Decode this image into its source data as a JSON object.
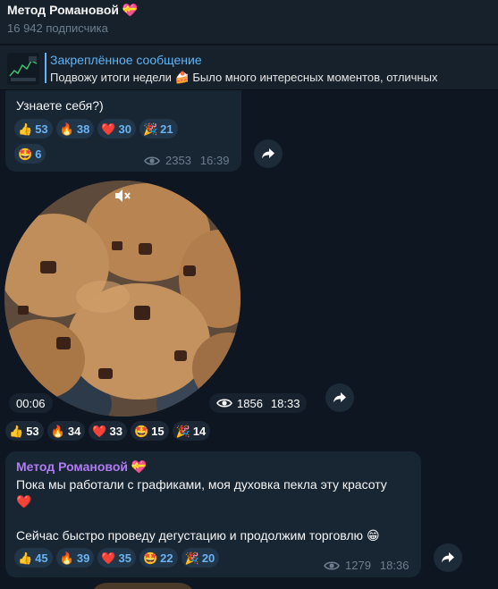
{
  "channel": {
    "title": "Метод Романовой",
    "title_emoji": "💝",
    "subscribers": "16 942 подписчика"
  },
  "pinned": {
    "label": "Закреплённое сообщение",
    "text": "Подвожу итоги недели 🍰   Было много интересных моментов, отличных"
  },
  "message1": {
    "text": "Узнаете себя?)",
    "reactions": [
      {
        "emoji": "👍",
        "count": "53"
      },
      {
        "emoji": "🔥",
        "count": "38"
      },
      {
        "emoji": "❤️",
        "count": "30"
      },
      {
        "emoji": "🎉",
        "count": "21"
      },
      {
        "emoji": "🤩",
        "count": "6"
      }
    ],
    "views": "2353",
    "time": "16:39"
  },
  "video_message": {
    "duration": "00:06",
    "views": "1856",
    "time": "18:33",
    "reactions": [
      {
        "emoji": "👍",
        "count": "53"
      },
      {
        "emoji": "🔥",
        "count": "34"
      },
      {
        "emoji": "❤️",
        "count": "33"
      },
      {
        "emoji": "🤩",
        "count": "15"
      },
      {
        "emoji": "🎉",
        "count": "14"
      }
    ]
  },
  "message2": {
    "sender": "Метод Романовой",
    "sender_emoji": "💝",
    "line1": "Пока мы работали с графиками, моя духовка пекла эту красоту",
    "line1_emoji": "❤️",
    "line2": "Сейчас быстро проведу дегустацию и продолжим торговлю",
    "line2_emoji": "😁",
    "reactions": [
      {
        "emoji": "👍",
        "count": "45"
      },
      {
        "emoji": "🔥",
        "count": "39"
      },
      {
        "emoji": "❤️",
        "count": "35"
      },
      {
        "emoji": "🤩",
        "count": "22"
      },
      {
        "emoji": "🎉",
        "count": "20"
      }
    ],
    "views": "1279",
    "time": "18:36"
  },
  "icons": {
    "share": "share-arrow-icon",
    "views": "eye-icon",
    "mute": "speaker-muted-icon"
  },
  "colors": {
    "background": "#0e1621",
    "bubble": "#182533",
    "accent": "#5eb5f7",
    "sender": "#b07cf2",
    "meta": "#6d7f8f"
  }
}
